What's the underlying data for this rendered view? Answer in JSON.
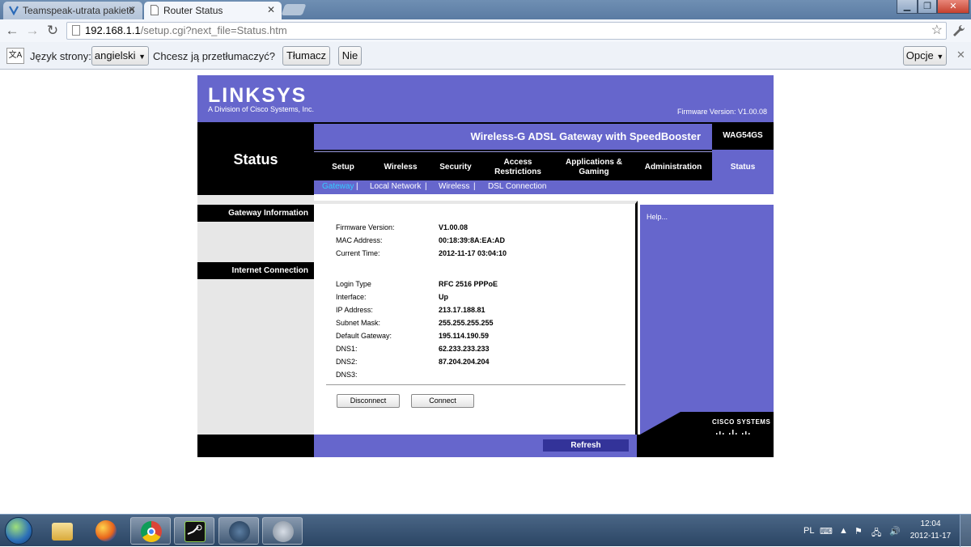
{
  "browser": {
    "tabs": [
      {
        "title": "Teamspeak-utrata pakietó",
        "active": false
      },
      {
        "title": "Router Status",
        "active": true
      }
    ],
    "url_host": "192.168.1.1",
    "url_path": "/setup.cgi?next_file=Status.htm",
    "translate_bar": {
      "language_label": "Język strony:",
      "language_value": "angielski",
      "question": "Chcesz ją przetłumaczyć?",
      "translate_button": "Tłumacz",
      "no_button": "Nie",
      "options_button": "Opcje"
    }
  },
  "router": {
    "brand": "LINKSYS",
    "brand_sub": "A Division of Cisco Systems, Inc.",
    "firmware_header": "Firmware Version: V1.00.08",
    "page_title": "Status",
    "product_name": "Wireless-G ADSL Gateway with SpeedBooster",
    "model": "WAG54GS",
    "main_tabs": [
      {
        "label": "Setup"
      },
      {
        "label": "Wireless"
      },
      {
        "label": "Security"
      },
      {
        "label": "Access\nRestrictions"
      },
      {
        "label": "Applications &\nGaming"
      },
      {
        "label": "Administration"
      },
      {
        "label": "Status"
      }
    ],
    "sub_tabs": [
      "Gateway",
      "Local Network",
      "Wireless",
      "DSL Connection"
    ],
    "sections": [
      "Gateway Information",
      "Internet Connection"
    ],
    "gateway_info": [
      {
        "label": "Firmware Version:",
        "value": "V1.00.08"
      },
      {
        "label": "MAC Address:",
        "value": "00:18:39:8A:EA:AD"
      },
      {
        "label": "Current Time:",
        "value": "2012-11-17 03:04:10"
      }
    ],
    "internet_info": [
      {
        "label": "Login Type",
        "value": "RFC 2516 PPPoE"
      },
      {
        "label": "Interface:",
        "value": "Up"
      },
      {
        "label": "IP Address:",
        "value": "213.17.188.81"
      },
      {
        "label": "Subnet Mask:",
        "value": "255.255.255.255"
      },
      {
        "label": "Default Gateway:",
        "value": "195.114.190.59"
      },
      {
        "label": "DNS1:",
        "value": "62.233.233.233"
      },
      {
        "label": "DNS2:",
        "value": "87.204.204.204"
      },
      {
        "label": "DNS3:",
        "value": ""
      }
    ],
    "disconnect_button": "Disconnect",
    "connect_button": "Connect",
    "help_link": "Help...",
    "cisco_logo": "CISCO SYSTEMS",
    "refresh_button": "Refresh"
  },
  "taskbar": {
    "language": "PL",
    "time": "12:04",
    "date": "2012-11-17"
  },
  "colors": {
    "linksys_purple": "#6666cc",
    "accent_link": "#33ccff"
  }
}
